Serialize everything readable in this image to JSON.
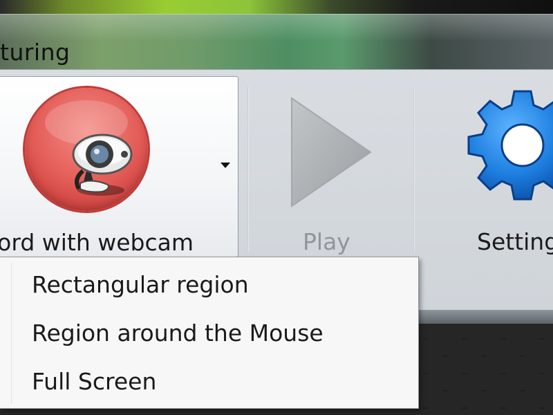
{
  "window": {
    "title": "turing"
  },
  "toolbar": {
    "record_label": "cord with webcam",
    "play_label": "Play",
    "settings_label": "Setting"
  },
  "dropdown": {
    "items": [
      {
        "label": "Rectangular region"
      },
      {
        "label": "Region around the Mouse"
      },
      {
        "label": "Full Screen"
      }
    ]
  },
  "icons": {
    "record": "webcam-record-icon",
    "dropdown": "dropdown-arrow-icon",
    "play": "play-icon",
    "settings": "gear-icon"
  },
  "colors": {
    "record_red": "#e25a55",
    "settings_blue": "#1e7fe0",
    "play_disabled": "#a9adb1",
    "menu_background": "#f7f7f7"
  },
  "state": {
    "play_enabled": false,
    "dropdown_open": true
  }
}
